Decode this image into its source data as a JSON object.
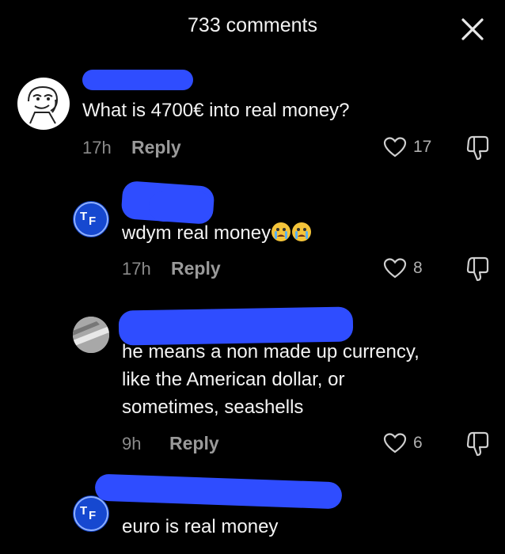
{
  "header": {
    "title": "733 comments"
  },
  "comments": [
    {
      "text": "What is 4700€ into real money?",
      "time": "17h",
      "reply_label": "Reply",
      "likes": "17",
      "avatar_icon": "meme-guy-avatar"
    },
    {
      "text": "wdym real money",
      "time": "17h",
      "reply_label": "Reply",
      "likes": "8",
      "avatar_icon": "tf-logo-avatar"
    },
    {
      "text_lines": [
        "he means a non made up currency,",
        "like the American dollar, or",
        "sometimes, seashells"
      ],
      "time": "9h",
      "reply_label": "Reply",
      "likes": "6",
      "avatar_icon": "photo-avatar"
    },
    {
      "text": "euro is real money",
      "avatar_icon": "tf-logo-avatar"
    }
  ],
  "colors": {
    "background": "#000000",
    "redaction": "#2f4dff",
    "muted": "#8a8a8a"
  }
}
